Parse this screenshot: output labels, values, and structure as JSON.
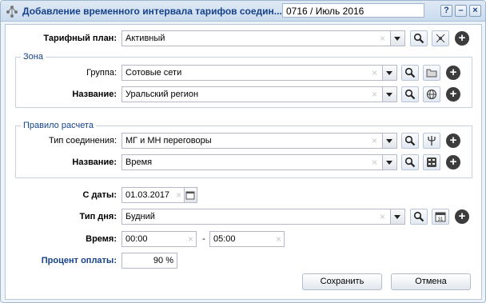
{
  "window": {
    "title": "Добавление временного интервала тарифов соедин...",
    "period": "0716 / Июль 2016",
    "tools": {
      "help": "?",
      "minimize": "–",
      "close": "×"
    }
  },
  "tariff_plan": {
    "label": "Тарифный план:",
    "value": "Активный"
  },
  "zone": {
    "legend": "Зона",
    "group": {
      "label": "Группа:",
      "value": "Сотовые сети"
    },
    "name": {
      "label": "Название:",
      "value": "Уральский регион"
    }
  },
  "rule": {
    "legend": "Правило расчета",
    "connection_type": {
      "label": "Тип соединения:",
      "value": "МГ и МН переговоры"
    },
    "name": {
      "label": "Название:",
      "value": "Время"
    }
  },
  "date_from": {
    "label": "С даты:",
    "value": "01.03.2017"
  },
  "day_type": {
    "label": "Тип дня:",
    "value": "Будний"
  },
  "time": {
    "label": "Время:",
    "from": "00:00",
    "separator": "-",
    "to": "05:00"
  },
  "payment_percent": {
    "label": "Процент оплаты:",
    "value": "90 %"
  },
  "buttons": {
    "save": "Сохранить",
    "cancel": "Отмена"
  },
  "clear_glyph": "×",
  "plus_glyph": "+",
  "calendar_day": "31"
}
